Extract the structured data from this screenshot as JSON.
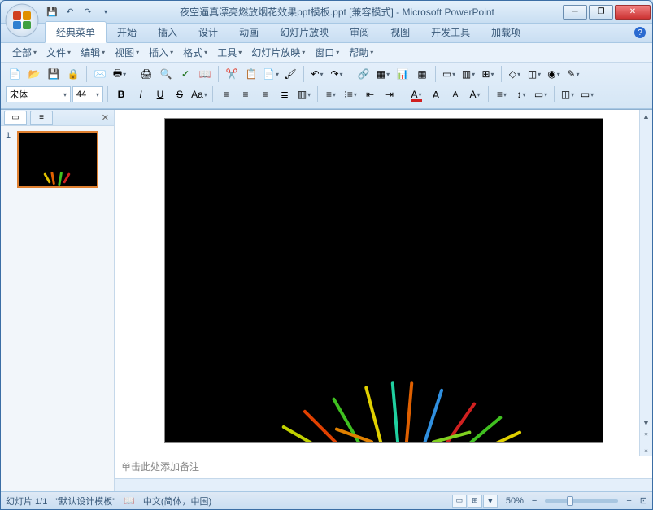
{
  "titlebar": {
    "title": "夜空逼真漂亮燃放烟花效果ppt模板.ppt [兼容模式] - Microsoft PowerPoint"
  },
  "ribbon_tabs": [
    "经典菜单",
    "开始",
    "插入",
    "设计",
    "动画",
    "幻灯片放映",
    "审阅",
    "视图",
    "开发工具",
    "加载项"
  ],
  "active_tab_index": 0,
  "classic_menu": [
    "全部",
    "文件",
    "编辑",
    "视图",
    "插入",
    "格式",
    "工具",
    "幻灯片放映",
    "窗口",
    "帮助"
  ],
  "font": {
    "name": "宋体",
    "size": "44"
  },
  "slides": {
    "current": 1,
    "count": 1
  },
  "notes_placeholder": "单击此处添加备注",
  "status": {
    "slide_label": "幻灯片 1/1",
    "template": "\"默认设计模板\"",
    "language": "中文(简体，中国)",
    "zoom": "50%"
  },
  "colors": {
    "accent": "#e08030"
  }
}
